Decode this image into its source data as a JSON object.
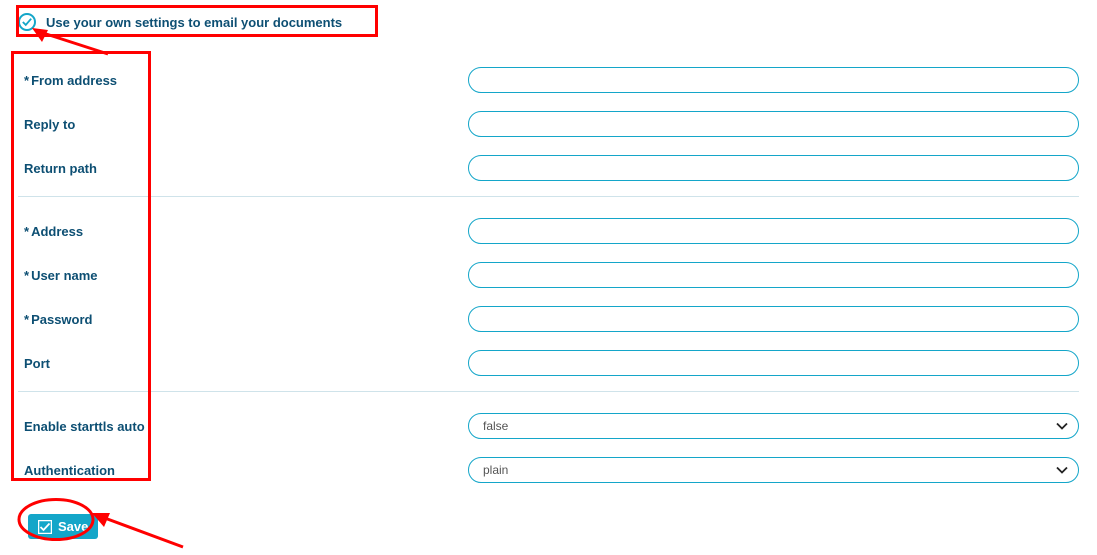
{
  "header": {
    "label": "Use your own settings to email your documents"
  },
  "fields": {
    "from_address": {
      "label": "From address",
      "required": true,
      "value": ""
    },
    "reply_to": {
      "label": "Reply to",
      "required": false,
      "value": ""
    },
    "return_path": {
      "label": "Return path",
      "required": false,
      "value": ""
    },
    "address": {
      "label": "Address",
      "required": true,
      "value": ""
    },
    "user_name": {
      "label": "User name",
      "required": true,
      "value": ""
    },
    "password": {
      "label": "Password",
      "required": true,
      "value": ""
    },
    "port": {
      "label": "Port",
      "required": false,
      "value": ""
    },
    "enable_starttls": {
      "label": "Enable starttls auto",
      "value": "false"
    },
    "authentication": {
      "label": "Authentication",
      "value": "plain"
    }
  },
  "actions": {
    "save_label": "Save"
  }
}
